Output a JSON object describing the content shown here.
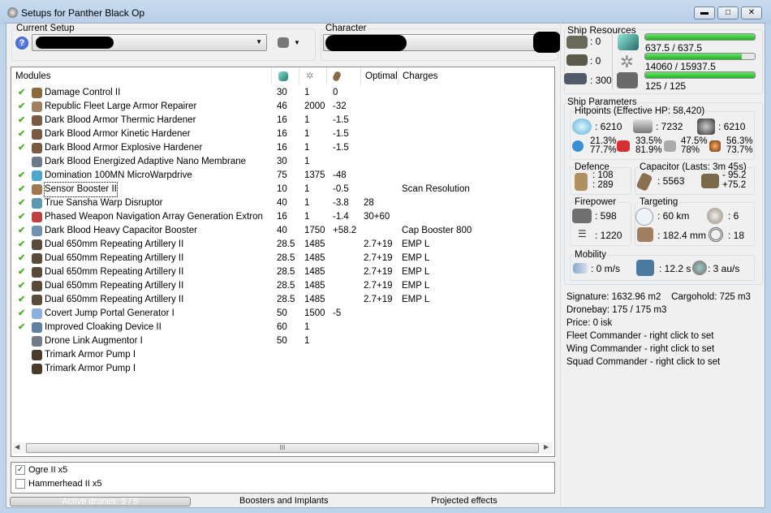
{
  "window": {
    "title": "Setups for Panther Black Op",
    "minimize": "▬",
    "maximize": "□",
    "close": "✕"
  },
  "setup": {
    "label": "Current Setup",
    "help": "?",
    "character_label": "Character"
  },
  "table": {
    "headers": {
      "modules": "Modules",
      "optimal": "Optimal",
      "charges": "Charges"
    },
    "rows": [
      {
        "active": true,
        "name": "Damage Control II",
        "cpu": "30",
        "pg": "1",
        "cap": "0",
        "optimal": "",
        "charges": "",
        "color": "#8a6a3a"
      },
      {
        "active": true,
        "name": "Republic Fleet Large Armor Repairer",
        "cpu": "46",
        "pg": "2000",
        "cap": "-32",
        "optimal": "",
        "charges": "",
        "color": "#a08060"
      },
      {
        "active": true,
        "name": "Dark Blood Armor Thermic Hardener",
        "cpu": "16",
        "pg": "1",
        "cap": "-1.5",
        "optimal": "",
        "charges": "",
        "color": "#7a5a40"
      },
      {
        "active": true,
        "name": "Dark Blood Armor Kinetic Hardener",
        "cpu": "16",
        "pg": "1",
        "cap": "-1.5",
        "optimal": "",
        "charges": "",
        "color": "#7a5a40"
      },
      {
        "active": true,
        "name": "Dark Blood Armor Explosive Hardener",
        "cpu": "16",
        "pg": "1",
        "cap": "-1.5",
        "optimal": "",
        "charges": "",
        "color": "#7a5a40"
      },
      {
        "active": false,
        "name": "Dark Blood Energized Adaptive Nano Membrane",
        "cpu": "30",
        "pg": "1",
        "cap": "",
        "optimal": "",
        "charges": "",
        "color": "#6a7a8a"
      },
      {
        "active": true,
        "name": "Domination 100MN MicroWarpdrive",
        "cpu": "75",
        "pg": "1375",
        "cap": "-48",
        "optimal": "",
        "charges": "",
        "color": "#4aa8d0"
      },
      {
        "active": true,
        "name": "Sensor Booster II",
        "cpu": "10",
        "pg": "1",
        "cap": "-0.5",
        "optimal": "",
        "charges": "Scan Resolution",
        "color": "#a07850",
        "focused": true
      },
      {
        "active": true,
        "name": "True Sansha Warp Disruptor",
        "cpu": "40",
        "pg": "1",
        "cap": "-3.8",
        "optimal": "28",
        "charges": "",
        "color": "#5a9ab0"
      },
      {
        "active": true,
        "name": "Phased Weapon Navigation Array Generation Extron",
        "cpu": "16",
        "pg": "1",
        "cap": "-1.4",
        "optimal": "30+60",
        "charges": "",
        "color": "#c04040"
      },
      {
        "active": true,
        "name": "Dark Blood Heavy Capacitor Booster",
        "cpu": "40",
        "pg": "1750",
        "cap": "+58.2",
        "optimal": "",
        "charges": "Cap Booster 800",
        "color": "#7090b0"
      },
      {
        "active": true,
        "name": "Dual 650mm Repeating Artillery II",
        "cpu": "28.5",
        "pg": "1485",
        "cap": "",
        "optimal": "2.7+19",
        "charges": "EMP L",
        "color": "#5a4a3a"
      },
      {
        "active": true,
        "name": "Dual 650mm Repeating Artillery II",
        "cpu": "28.5",
        "pg": "1485",
        "cap": "",
        "optimal": "2.7+19",
        "charges": "EMP L",
        "color": "#5a4a3a"
      },
      {
        "active": true,
        "name": "Dual 650mm Repeating Artillery II",
        "cpu": "28.5",
        "pg": "1485",
        "cap": "",
        "optimal": "2.7+19",
        "charges": "EMP L",
        "color": "#5a4a3a"
      },
      {
        "active": true,
        "name": "Dual 650mm Repeating Artillery II",
        "cpu": "28.5",
        "pg": "1485",
        "cap": "",
        "optimal": "2.7+19",
        "charges": "EMP L",
        "color": "#5a4a3a"
      },
      {
        "active": true,
        "name": "Dual 650mm Repeating Artillery II",
        "cpu": "28.5",
        "pg": "1485",
        "cap": "",
        "optimal": "2.7+19",
        "charges": "EMP L",
        "color": "#5a4a3a"
      },
      {
        "active": true,
        "name": "Covert Jump Portal Generator I",
        "cpu": "50",
        "pg": "1500",
        "cap": "-5",
        "optimal": "",
        "charges": "",
        "color": "#8ab0e0"
      },
      {
        "active": true,
        "name": "Improved Cloaking Device II",
        "cpu": "60",
        "pg": "1",
        "cap": "",
        "optimal": "",
        "charges": "",
        "color": "#6080a0"
      },
      {
        "active": false,
        "name": "Drone Link Augmentor I",
        "cpu": "50",
        "pg": "1",
        "cap": "",
        "optimal": "",
        "charges": "",
        "color": "#707a88"
      },
      {
        "active": false,
        "name": "Trimark Armor Pump I",
        "cpu": "",
        "pg": "",
        "cap": "",
        "optimal": "",
        "charges": "",
        "color": "#4a3a2a"
      },
      {
        "active": false,
        "name": "Trimark Armor Pump I",
        "cpu": "",
        "pg": "",
        "cap": "",
        "optimal": "",
        "charges": "",
        "color": "#4a3a2a"
      }
    ],
    "scroll_grip": "III"
  },
  "drones": [
    {
      "name": "Ogre II x5",
      "checked": true
    },
    {
      "name": "Hammerhead II x5",
      "checked": false
    }
  ],
  "bottom": {
    "active_drones": "Active drones: 5 / 5",
    "boosters": "Boosters and Implants",
    "projected": "Projected effects"
  },
  "resources": {
    "title": "Ship Resources",
    "turrets": ": 0",
    "launchers": ": 0",
    "calibration": ": 300",
    "cpu": "637.5 / 637.5",
    "cpu_fraction": 1.0,
    "powergrid": "14060 / 15937.5",
    "powergrid_fraction": 0.882,
    "drone_bandwidth": "125 / 125",
    "drone_bandwidth_fraction": 1.0
  },
  "parameters": {
    "title": "Ship Parameters",
    "hitpoints_title": "Hitpoints (Effective HP: 58,420)",
    "shield": ": 6210",
    "armor": ": 7232",
    "structure": ": 6210",
    "resists": [
      {
        "a": "21.3%",
        "b": "77.7%"
      },
      {
        "a": "33.5%",
        "b": "81.9%"
      },
      {
        "a": "47.5%",
        "b": "78%"
      },
      {
        "a": "56.3%",
        "b": "73.7%"
      }
    ],
    "defence_title": "Defence",
    "defence_a": ": 108",
    "defence_b": ": 289",
    "capacitor_title": "Capacitor (Lasts: 3m 45s)",
    "capacitor": ": 5563",
    "cap_minus": "- 95.2",
    "cap_plus": "+75.2",
    "firepower_title": "Firepower",
    "dps": ": 598",
    "volley": ": 1220",
    "targeting_title": "Targeting",
    "range": ": 60 km",
    "max_targets": ": 6",
    "scan_res": ": 182.4 mm",
    "sensor": ": 18",
    "mobility_title": "Mobility",
    "speed": ": 0 m/s",
    "align": ": 12.2 s",
    "warp": ": 3 au/s"
  },
  "info": {
    "signature": "Signature: 1632.96 m2",
    "cargohold": "Cargohold: 725 m3",
    "dronebay": "Dronebay: 175 / 175 m3",
    "price": "Price: 0 isk",
    "fleet": "Fleet Commander - right click to set",
    "wing": "Wing Commander - right click to set",
    "squad": "Squad Commander - right click to set"
  }
}
